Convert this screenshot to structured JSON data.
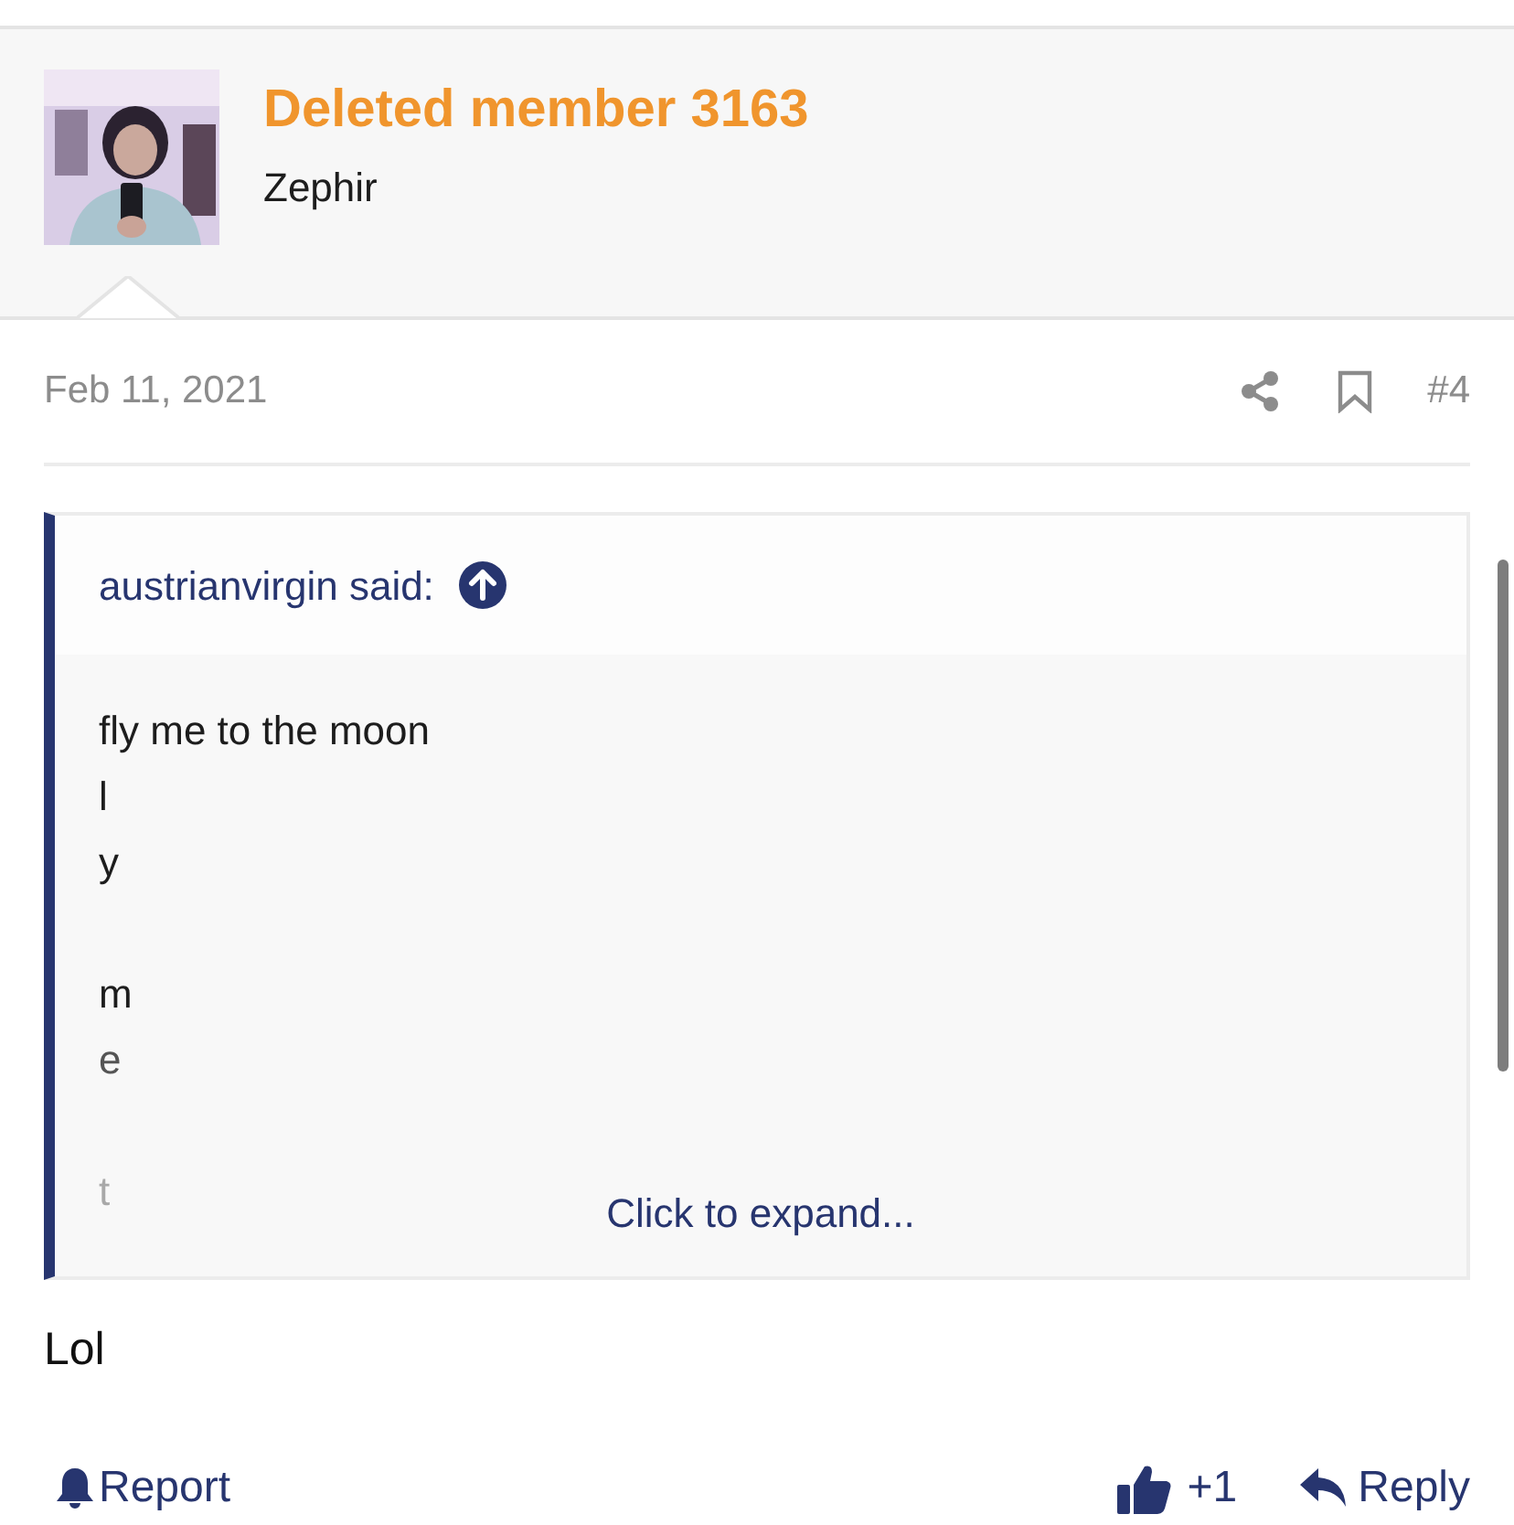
{
  "author": {
    "name": "Deleted member 3163",
    "title": "Zephir"
  },
  "post": {
    "date": "Feb 11, 2021",
    "number": "#4",
    "quote": {
      "attribution": "austrianvirgin said:",
      "lines": [
        {
          "text": "fly me to the moon",
          "gap_before": false
        },
        {
          "text": "l",
          "gap_before": false
        },
        {
          "text": "y",
          "gap_before": false
        },
        {
          "text": "m",
          "gap_before": true
        },
        {
          "text": "e",
          "gap_before": false
        },
        {
          "text": "t",
          "gap_before": true
        }
      ],
      "expand": "Click to expand..."
    },
    "body": "Lol",
    "actions": {
      "report": "Report",
      "like_count": "+1",
      "reply": "Reply"
    }
  }
}
